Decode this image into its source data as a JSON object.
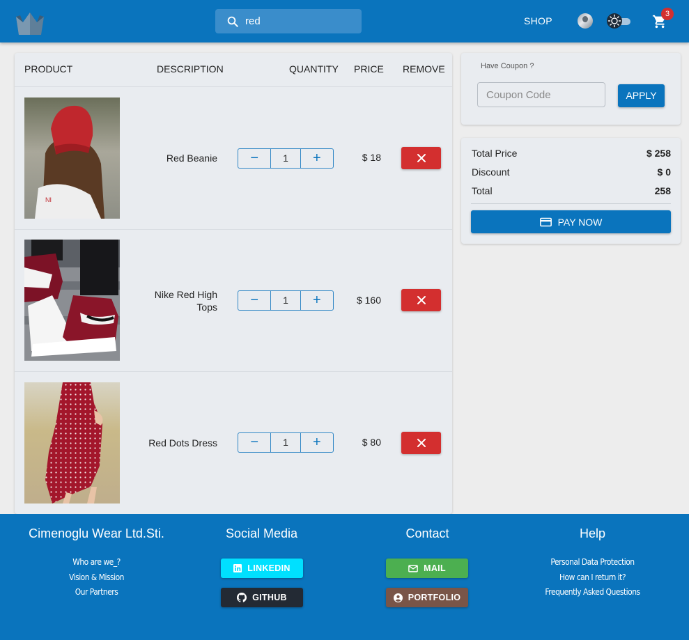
{
  "header": {
    "search_value": "red",
    "shop_label": "SHOP",
    "cart_count": "3",
    "icons": [
      "crown-logo-icon",
      "search-icon",
      "user-avatar",
      "theme-toggle-icon",
      "cart-icon"
    ]
  },
  "table": {
    "headers": {
      "product": "PRODUCT",
      "description": "DESCRIPTION",
      "quantity": "QUANTITY",
      "price": "PRICE",
      "remove": "REMOVE"
    },
    "rows": [
      {
        "description": "Red Beanie",
        "quantity": "1",
        "price": "$ 18"
      },
      {
        "description": "Nike Red High Tops",
        "quantity": "1",
        "price": "$ 160"
      },
      {
        "description": "Red Dots Dress",
        "quantity": "1",
        "price": "$ 80"
      }
    ]
  },
  "coupon": {
    "label": "Have Coupon ?",
    "placeholder": "Coupon Code",
    "apply_label": "APPLY"
  },
  "summary": {
    "total_price_label": "Total Price",
    "total_price_value": "$ 258",
    "discount_label": "Discount",
    "discount_value": "$ 0",
    "total_label": "Total",
    "total_value": "258",
    "pay_label": "PAY NOW"
  },
  "footer": {
    "company": {
      "title": "Cimenoglu Wear Ltd.Sti.",
      "links": [
        "Who are we_?",
        "Vision & Mission",
        "Our Partners"
      ]
    },
    "social": {
      "title": "Social Media",
      "linkedin_label": "LINKEDIN",
      "github_label": "GITHUB"
    },
    "contact": {
      "title": "Contact",
      "mail_label": "MAIL",
      "portfolio_label": "PORTFOLIO"
    },
    "help": {
      "title": "Help",
      "links": [
        "Personal Data Protection",
        "How can I return it?",
        "Frequently Asked Questions"
      ]
    }
  },
  "colors": {
    "primary": "#0a74bd",
    "danger": "#d32f2f",
    "linkedin": "#00e0ff",
    "github": "#232a34",
    "mail": "#4caf50",
    "portfolio": "#795548"
  }
}
